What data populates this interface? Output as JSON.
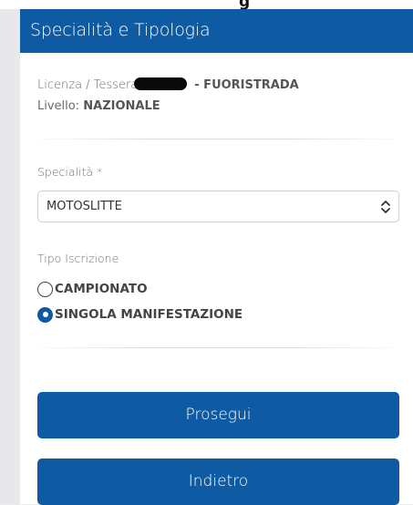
{
  "top_fragment": "g",
  "header": {
    "title": "Specialità e Tipologia"
  },
  "license": {
    "label": "Licenza / Tessera",
    "type": "- FUORISTRADA",
    "level_label": "Livello:",
    "level_value": "NAZIONALE"
  },
  "specialty": {
    "label": "Specialità *",
    "selected": "MOTOSLITTE"
  },
  "registration": {
    "label": "Tipo Iscrizione",
    "options": [
      {
        "label": "CAMPIONATO",
        "selected": false
      },
      {
        "label": "SINGOLA MANIFESTAZIONE",
        "selected": true
      }
    ]
  },
  "buttons": {
    "proceed": "Prosegui",
    "back": "Indietro"
  },
  "colors": {
    "primary": "#0e5aa3"
  }
}
